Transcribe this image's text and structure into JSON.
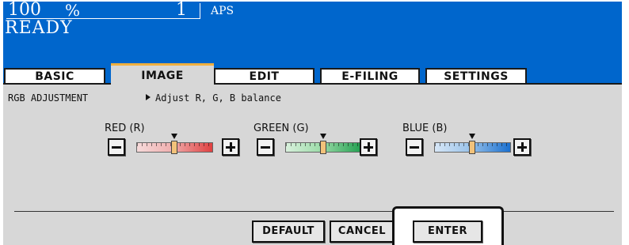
{
  "status": {
    "zoom_value": "100",
    "zoom_unit": "%",
    "copies": "1",
    "paper": "APS",
    "message": "READY"
  },
  "tabs": [
    {
      "label": "BASIC"
    },
    {
      "label": "IMAGE"
    },
    {
      "label": "EDIT"
    },
    {
      "label": "E-FILING"
    },
    {
      "label": "SETTINGS"
    }
  ],
  "screen": {
    "title": "RGB ADJUSTMENT",
    "description": "Adjust R, G, B balance"
  },
  "sliders": [
    {
      "label": "RED (R)",
      "color": "#e04040",
      "level": 0.5
    },
    {
      "label": "GREEN (G)",
      "color": "#22a050",
      "level": 0.5
    },
    {
      "label": "BLUE (B)",
      "color": "#1a70d0",
      "level": 0.5
    }
  ],
  "buttons": {
    "default": "DEFAULT",
    "cancel": "CANCEL",
    "enter": "ENTER"
  }
}
